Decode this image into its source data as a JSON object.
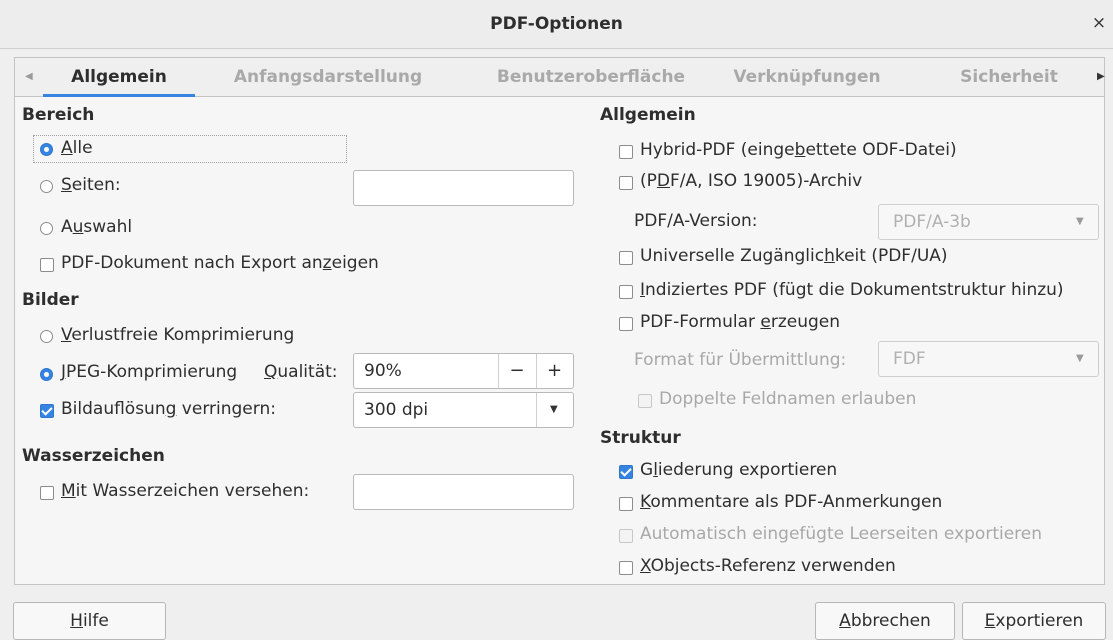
{
  "window": {
    "title": "PDF-Optionen",
    "close_glyph": "×"
  },
  "tabs": [
    {
      "label": "Allgemein",
      "active": true
    },
    {
      "label": "Anfangsdarstellung",
      "active": false
    },
    {
      "label": "Benutzeroberfläche",
      "active": false
    },
    {
      "label": "Verknüpfungen",
      "active": false
    },
    {
      "label": "Sicherheit",
      "active": false
    }
  ],
  "tab_arrows": {
    "left": "◀",
    "right": "▶"
  },
  "left": {
    "bereich": {
      "heading": "Bereich",
      "alle": {
        "pre": "",
        "acc": "A",
        "post": "lle",
        "selected": true
      },
      "seiten": {
        "pre": "",
        "acc": "S",
        "post": "eiten:",
        "selected": false,
        "value": ""
      },
      "auswahl": {
        "pre": "A",
        "acc": "u",
        "post": "swahl",
        "selected": false
      },
      "show_after": {
        "pre": "PDF-Dokument nach Export an",
        "acc": "z",
        "post": "eigen",
        "checked": false
      }
    },
    "bilder": {
      "heading": "Bilder",
      "lossless": {
        "pre": "",
        "acc": "V",
        "post": "erlustfreie Komprimierung",
        "selected": false
      },
      "jpeg": {
        "pre": "",
        "acc": "J",
        "post": "PEG-Komprimierung",
        "selected": true
      },
      "quality": {
        "pre": "",
        "acc": "Q",
        "post": "ualität:",
        "value": "90%",
        "minus": "−",
        "plus": "+"
      },
      "reduce": {
        "pre": "Bildauflösun",
        "acc": "g",
        "post": " verringern:",
        "checked": true,
        "value": "300 dpi"
      }
    },
    "watermark": {
      "heading": "Wasserzeichen",
      "sign": {
        "pre": "",
        "acc": "M",
        "post": "it Wasserzeichen versehen:",
        "checked": false,
        "value": ""
      }
    }
  },
  "right": {
    "allgemein": {
      "heading": "Allgemein",
      "hybrid": {
        "pre": "Hybrid-PDF (einge",
        "acc": "b",
        "post": "ettete ODF-Datei)",
        "checked": false
      },
      "pdfa": {
        "pre": "(P",
        "acc": "D",
        "post": "F/A, ISO 19005)-Archiv",
        "checked": false
      },
      "pdfa_version_label": "PDF/A-Version:",
      "pdfa_version_value": "PDF/A-3b",
      "ua": {
        "pre": "Universelle Zugänglic",
        "acc": "h",
        "post": "keit (PDF/UA)",
        "checked": false
      },
      "tagged": {
        "pre": "",
        "acc": "I",
        "post": "ndiziertes PDF (fügt die Dokumentstruktur hinzu)",
        "checked": false
      },
      "form": {
        "pre": "PDF-Formular ",
        "acc": "e",
        "post": "rzeugen",
        "checked": false
      },
      "submit_format_label": "Format für Übermittlung:",
      "submit_format_value": "FDF",
      "dup_fields": {
        "label": "Doppelte Feldnamen erlauben",
        "checked": false
      }
    },
    "struktur": {
      "heading": "Struktur",
      "outline": {
        "pre": "G",
        "acc": "l",
        "post": "iederung exportieren",
        "checked": true
      },
      "comments": {
        "pre": "",
        "acc": "K",
        "post": "ommentare als PDF-Anmerkungen",
        "checked": false
      },
      "empty_pages": {
        "label": "Automatisch eingefügte Leerseiten exportieren",
        "checked": false
      },
      "xobjects": {
        "pre": "",
        "acc": "X",
        "post": "Objects-Referenz verwenden",
        "checked": false
      }
    }
  },
  "footer": {
    "help": {
      "pre": "",
      "acc": "H",
      "post": "ilfe"
    },
    "cancel": {
      "pre": "",
      "acc": "A",
      "post": "bbrechen"
    },
    "export": {
      "pre": "",
      "acc": "E",
      "post": "xportieren"
    }
  },
  "colors": {
    "accent": "#3584e4",
    "disabled_text": "#a8a8a8"
  }
}
